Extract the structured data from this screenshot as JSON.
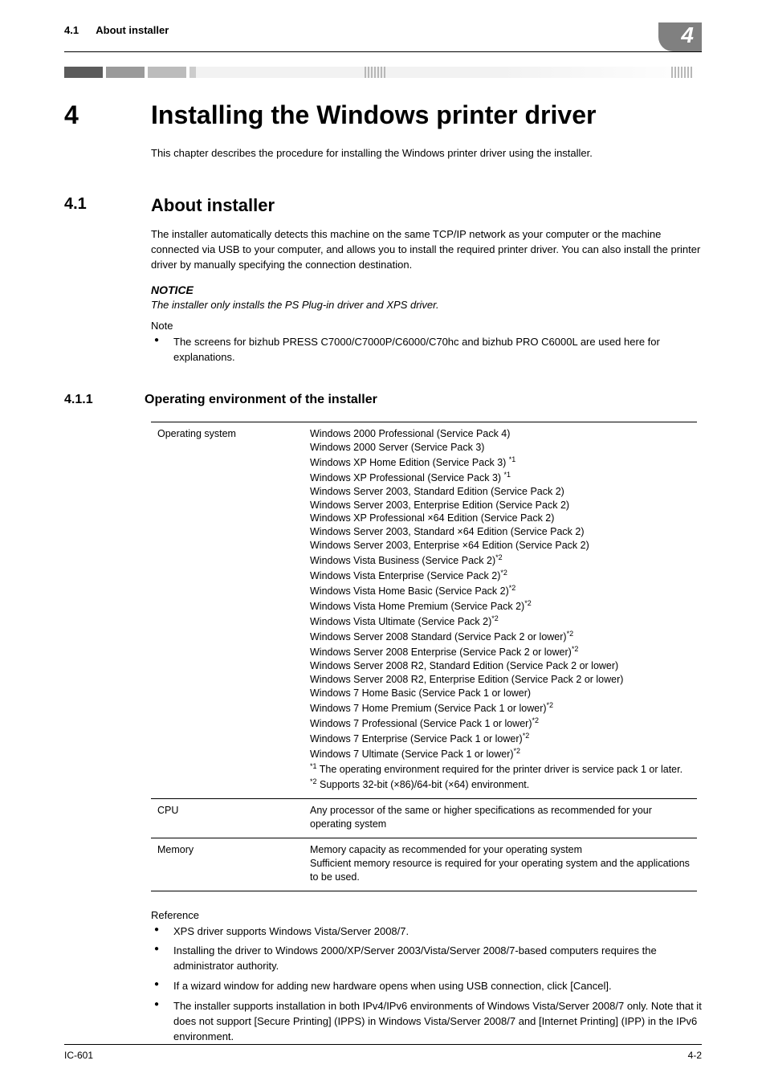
{
  "header": {
    "section_ref": "4.1",
    "section_title": "About installer",
    "chapter_badge": "4"
  },
  "chapter": {
    "number": "4",
    "title": "Installing the Windows printer driver",
    "intro": "This chapter describes the procedure for installing the Windows printer driver using the installer."
  },
  "section_4_1": {
    "number": "4.1",
    "title": "About installer",
    "body": "The installer automatically detects this machine on the same TCP/IP network as your computer or the machine connected via USB to your computer, and allows you to install the required printer driver. You can also install the printer driver by manually specifying the connection destination.",
    "notice_label": "NOTICE",
    "notice_text": "The installer only installs the PS Plug-in driver and XPS driver.",
    "note_label": "Note",
    "note_bullet": "The screens for bizhub PRESS C7000/C7000P/C6000/C70hc and bizhub PRO C6000L are used here for explanations."
  },
  "subsection_4_1_1": {
    "number": "4.1.1",
    "title": "Operating environment of the installer",
    "table": {
      "os_label": "Operating system",
      "os_lines": [
        "Windows 2000 Professional (Service Pack 4)",
        "Windows 2000 Server (Service Pack 3)",
        "Windows XP Home Edition (Service Pack 3) *1",
        "Windows XP Professional (Service Pack 3) *1",
        "Windows Server 2003, Standard Edition (Service Pack 2)",
        "Windows Server 2003, Enterprise Edition (Service Pack 2)",
        "Windows XP Professional ×64 Edition (Service Pack 2)",
        "Windows Server 2003, Standard ×64 Edition (Service Pack 2)",
        "Windows Server 2003, Enterprise ×64 Edition (Service Pack 2)",
        "Windows Vista Business (Service Pack 2)*2",
        "Windows Vista Enterprise (Service Pack 2)*2",
        "Windows Vista Home Basic (Service Pack 2)*2",
        "Windows Vista Home Premium (Service Pack 2)*2",
        "Windows Vista Ultimate (Service Pack 2)*2",
        "Windows Server 2008 Standard (Service Pack 2 or lower)*2",
        "Windows Server 2008 Enterprise (Service Pack 2 or lower)*2",
        "Windows Server 2008 R2, Standard Edition (Service Pack 2 or lower)",
        "Windows Server 2008 R2, Enterprise Edition (Service Pack 2 or lower)",
        "Windows 7 Home Basic (Service Pack 1 or lower)",
        "Windows 7 Home Premium (Service Pack 1 or lower)*2",
        "Windows 7 Professional (Service Pack 1 or lower)*2",
        "Windows 7 Enterprise (Service Pack 1 or lower)*2",
        "Windows 7 Ultimate (Service Pack 1 or lower)*2",
        "*1 The operating environment required for the printer driver is service pack 1 or later.",
        "*2 Supports 32-bit (×86)/64-bit (×64) environment."
      ],
      "cpu_label": "CPU",
      "cpu_value": "Any processor of the same or higher specifications as recommended for your operating system",
      "memory_label": "Memory",
      "memory_value": "Memory capacity as recommended for your operating system\nSufficient memory resource is required for your operating system and the applications to be used."
    },
    "reference_label": "Reference",
    "reference_bullets": [
      "XPS driver supports Windows Vista/Server 2008/7.",
      "Installing the driver to Windows 2000/XP/Server 2003/Vista/Server 2008/7-based computers requires the administrator authority.",
      "If a wizard window for adding new hardware opens when using USB connection, click [Cancel].",
      "The installer supports installation in both IPv4/IPv6 environments of Windows Vista/Server 2008/7 only. Note that it does not support [Secure Printing] (IPPS) in Windows Vista/Server 2008/7 and [Internet Printing] (IPP) in the IPv6 environment."
    ]
  },
  "footer": {
    "left": "IC-601",
    "right": "4-2"
  }
}
